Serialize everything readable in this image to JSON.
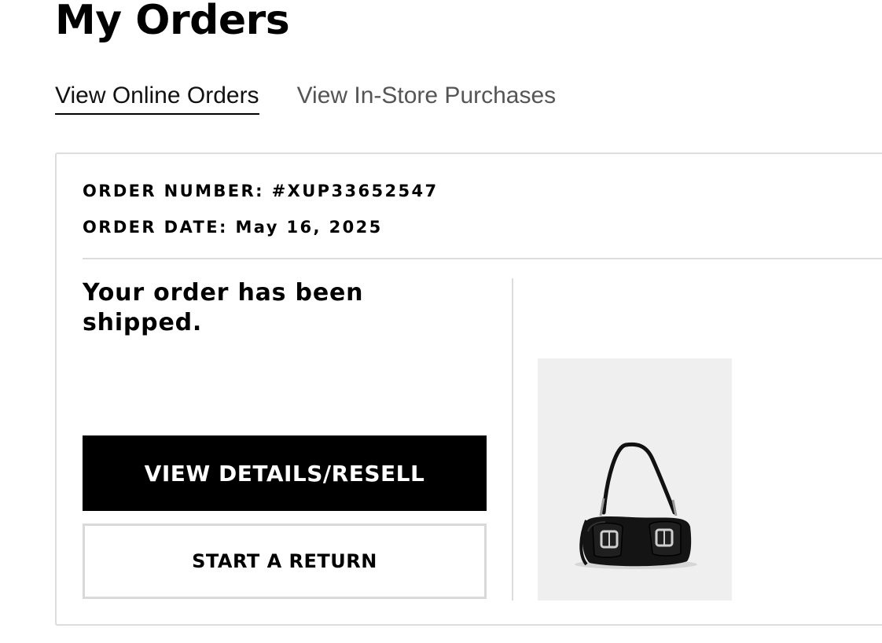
{
  "page": {
    "title": "My Orders"
  },
  "tabs": [
    {
      "label": "View Online Orders",
      "active": true
    },
    {
      "label": "View In-Store Purchases",
      "active": false
    }
  ],
  "order": {
    "number_line": "ORDER NUMBER: #XUP33652547",
    "date_line": "ORDER DATE: May 16, 2025",
    "status": "Your order has been shipped.",
    "primary_button": "VIEW DETAILS/RESELL",
    "secondary_button": "START A RETURN",
    "product_image": "black-shoulder-bag-with-buckle-pockets"
  },
  "colors": {
    "primary_button_bg": "#000000",
    "card_border": "#dcdcdc",
    "image_bg": "#efefef"
  }
}
